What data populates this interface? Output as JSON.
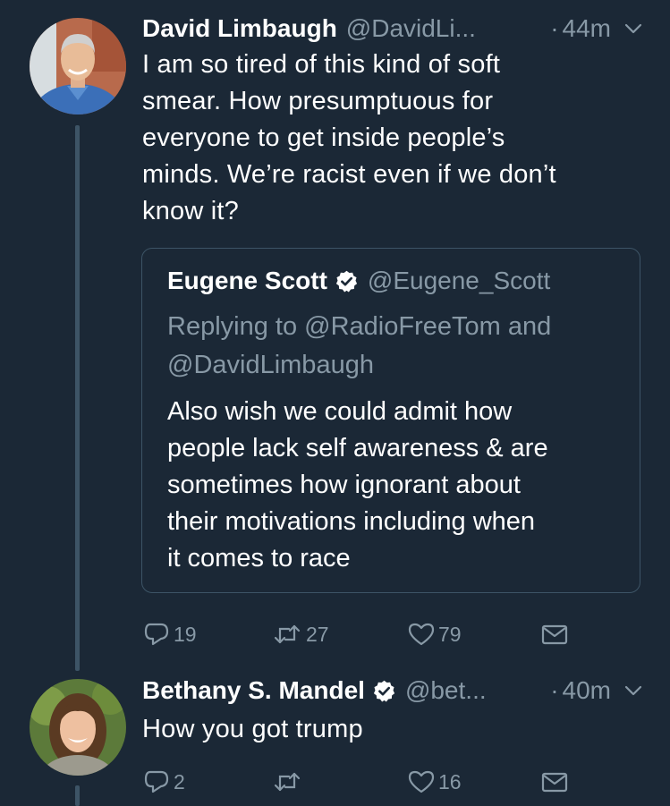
{
  "tweet1": {
    "name": "David Limbaugh",
    "handle": "@DavidLi...",
    "dot": "·",
    "time": "44m",
    "lines": [
      "I am so tired of this kind of soft",
      "smear. How presumptuous for",
      "everyone to get inside people’s",
      "minds. We’re racist even if we don’t",
      "know it?"
    ],
    "quote": {
      "name": "Eugene Scott",
      "handle": "@Eugene_Scott",
      "reply_lines": [
        "Replying to @RadioFreeTom and",
        "@DavidLimbaugh"
      ],
      "lines": [
        "Also wish we could admit how",
        "people lack self awareness & are",
        "sometimes how ignorant about",
        "their motivations including when",
        "it comes to race"
      ]
    },
    "actions": {
      "replies": "19",
      "retweets": "27",
      "likes": "79"
    }
  },
  "tweet2": {
    "name": "Bethany S. Mandel",
    "handle": "@bet...",
    "dot": "·",
    "time": "40m",
    "lines": [
      "How you got trump"
    ],
    "actions": {
      "replies": "2",
      "retweets": "",
      "likes": "16"
    }
  },
  "icons": {
    "reply": "reply-icon",
    "retweet": "retweet-icon",
    "like": "heart-icon",
    "dm": "envelope-icon",
    "verified": "verified-badge-icon",
    "caret": "chevron-down-icon"
  },
  "colors": {
    "background": "#1b2836",
    "secondary_text": "#8899a6",
    "border": "#3d5466"
  }
}
